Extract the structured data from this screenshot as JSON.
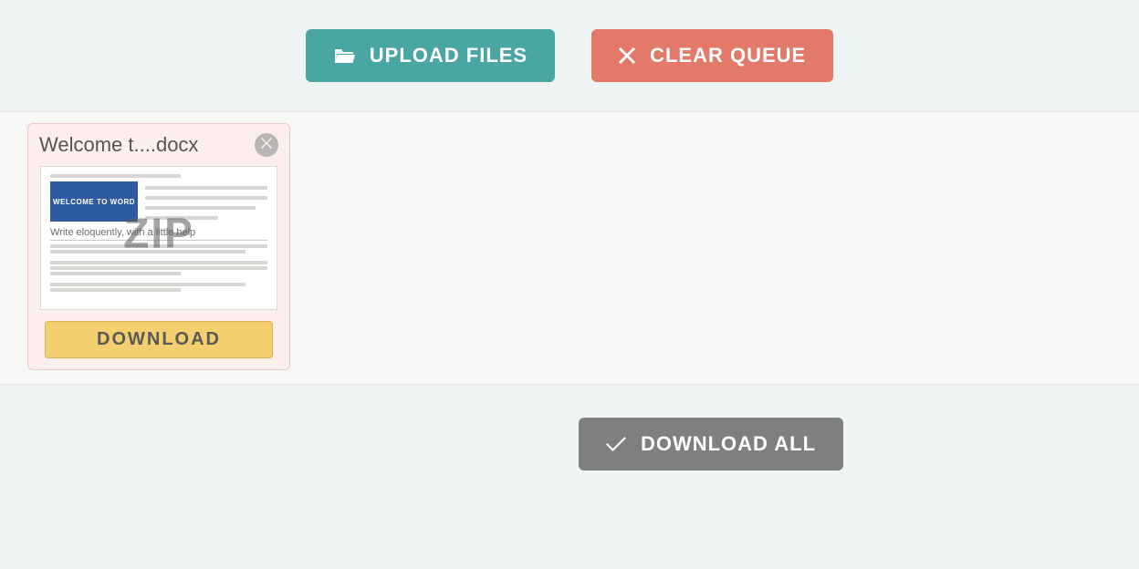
{
  "toolbar": {
    "upload_label": "UPLOAD FILES",
    "clear_label": "CLEAR QUEUE"
  },
  "file": {
    "name": "Welcome t....docx",
    "overlay_format": "ZIP",
    "preview_banner": "WELCOME TO WORD",
    "preview_heading": "Write eloquently, with a little help",
    "download_label": "DOWNLOAD"
  },
  "footer": {
    "download_all_label": "DOWNLOAD ALL"
  }
}
